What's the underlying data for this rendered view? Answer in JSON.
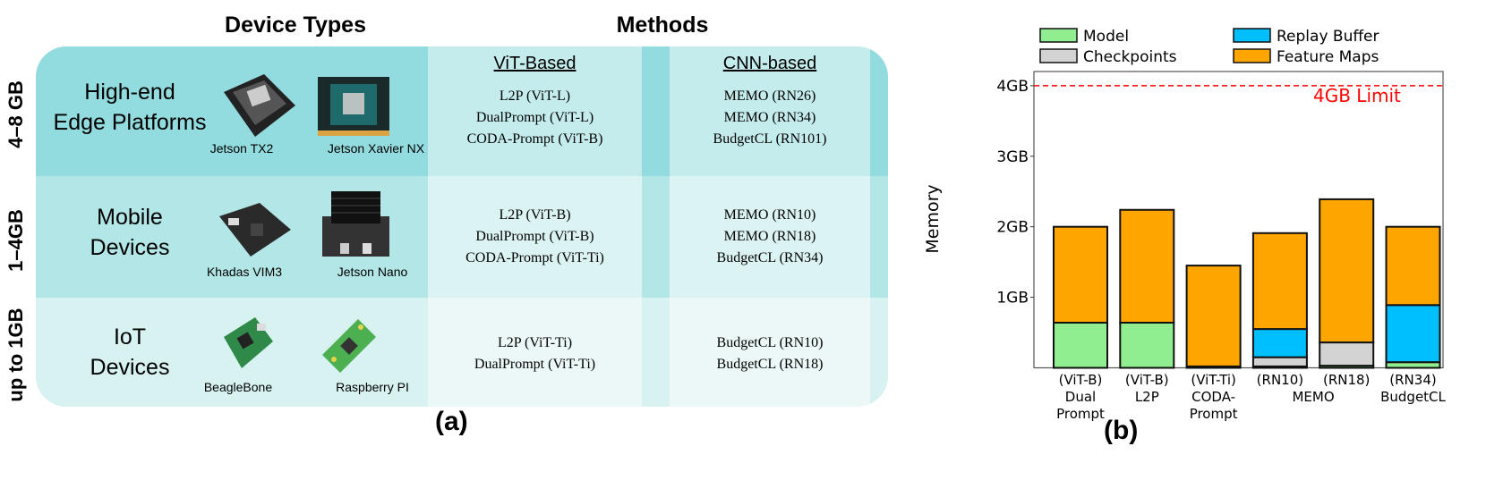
{
  "panel_a": {
    "caption": "(a)",
    "headers": {
      "devices": "Device Types",
      "methods": "Methods"
    },
    "method_groups": [
      "ViT-Based",
      "CNN-based"
    ],
    "rows": [
      {
        "memory": "4–8 GB",
        "title": [
          "High-end",
          "Edge Platforms"
        ],
        "devices": [
          "Jetson TX2",
          "Jetson Xavier NX"
        ],
        "vit": [
          "L2P (ViT-L)",
          "DualPrompt (ViT-L)",
          "CODA-Prompt (ViT-B)"
        ],
        "cnn": [
          "MEMO (RN26)",
          "MEMO (RN34)",
          "BudgetCL (RN101)"
        ]
      },
      {
        "memory": "1–4GB",
        "title": [
          "Mobile",
          "Devices"
        ],
        "devices": [
          "Khadas VIM3",
          "Jetson Nano"
        ],
        "vit": [
          "L2P (ViT-B)",
          "DualPrompt (ViT-B)",
          "CODA-Prompt (ViT-Ti)"
        ],
        "cnn": [
          "MEMO (RN10)",
          "MEMO (RN18)",
          "BudgetCL (RN34)"
        ]
      },
      {
        "memory": "up to 1GB",
        "title": [
          "IoT",
          "Devices"
        ],
        "devices": [
          "BeagleBone",
          "Raspberry PI"
        ],
        "vit": [
          "L2P (ViT-Ti)",
          "DualPrompt (ViT-Ti)"
        ],
        "cnn": [
          "BudgetCL (RN10)",
          "BudgetCL (RN18)"
        ]
      }
    ]
  },
  "chart_data": {
    "type": "bar",
    "stacked": true,
    "caption": "(b)",
    "ylabel": "Memory",
    "ylim": [
      0,
      4.2
    ],
    "yticks": [
      "1GB",
      "2GB",
      "3GB",
      "4GB"
    ],
    "ytick_values": [
      1,
      2,
      3,
      4
    ],
    "categories": [
      [
        "(ViT-B)",
        "Dual",
        "Prompt"
      ],
      [
        "(ViT-B)",
        "L2P"
      ],
      [
        "(ViT-Ti)",
        "CODA-",
        "Prompt"
      ],
      [
        "(RN10)"
      ],
      [
        "(RN18)"
      ],
      [
        "(RN34)",
        "BudgetCL"
      ]
    ],
    "group_label": "MEMO",
    "legend_position": "top",
    "series": [
      {
        "name": "Model",
        "color": "#90ee90",
        "values": [
          0.64,
          0.64,
          0.02,
          0.02,
          0.03,
          0.08
        ]
      },
      {
        "name": "Checkpoints",
        "color": "#d3d3d3",
        "values": [
          0,
          0,
          0,
          0.13,
          0.33,
          0
        ]
      },
      {
        "name": "Replay Buffer",
        "color": "#00bfff",
        "values": [
          0,
          0,
          0,
          0.4,
          0,
          0.81
        ]
      },
      {
        "name": "Feature Maps",
        "color": "#ffa500",
        "values": [
          1.36,
          1.6,
          1.43,
          1.36,
          2.03,
          1.11
        ]
      }
    ],
    "reference_line": {
      "value": 4,
      "label": "4GB Limit",
      "color": "#ff0000",
      "style": "dashed"
    }
  }
}
